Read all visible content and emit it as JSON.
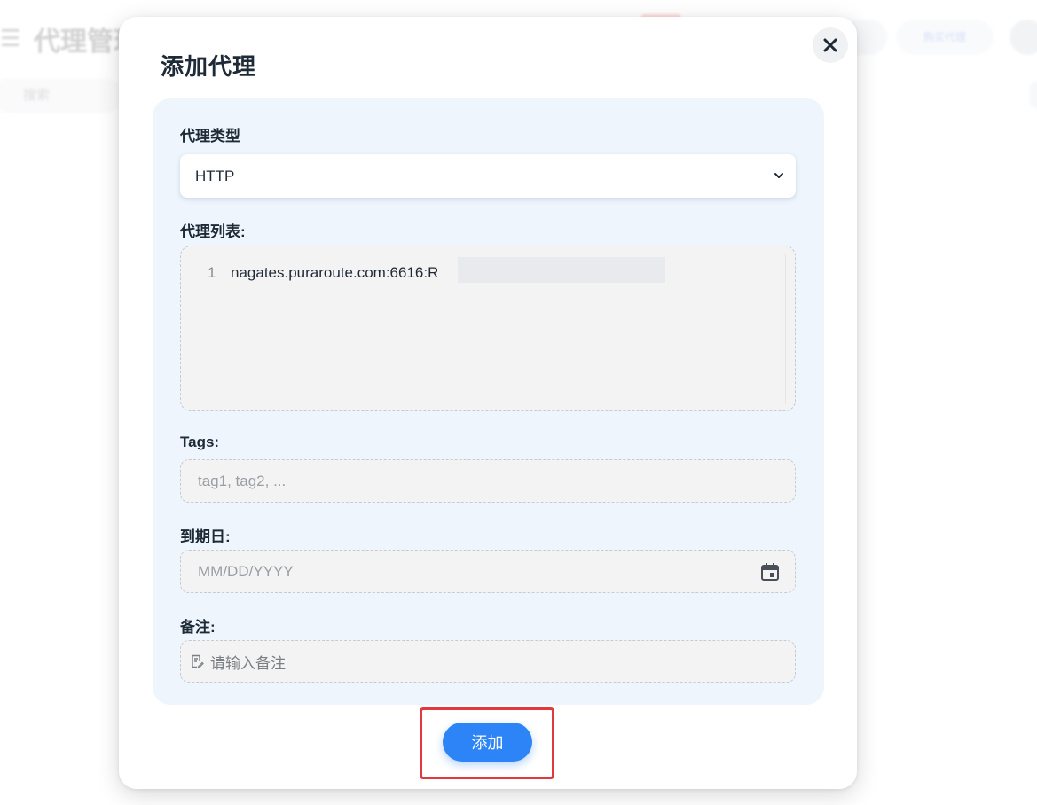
{
  "background": {
    "menu_icon": "menu-icon",
    "page_title": "代理管理",
    "search_placeholder": "搜索",
    "header_button_label": "购买代理"
  },
  "modal": {
    "title": "添加代理",
    "close_icon": "close-icon",
    "proxy_type": {
      "label": "代理类型",
      "selected": "HTTP",
      "icon": "chevron-down-icon"
    },
    "proxy_list": {
      "label": "代理列表:",
      "lines": [
        {
          "number": "1",
          "text": "nagates.puraroute.com:6616:R"
        }
      ]
    },
    "tags": {
      "label": "Tags:",
      "placeholder": "tag1, tag2, ..."
    },
    "expiry": {
      "label": "到期日:",
      "placeholder": "MM/DD/YYYY",
      "icon": "calendar-icon"
    },
    "notes": {
      "label": "备注:",
      "placeholder": "请输入备注",
      "icon": "note-icon"
    },
    "submit_label": "添加"
  },
  "colors": {
    "accent": "#2d84f6",
    "panel": "#eef5fd",
    "highlight": "#e0393e"
  }
}
